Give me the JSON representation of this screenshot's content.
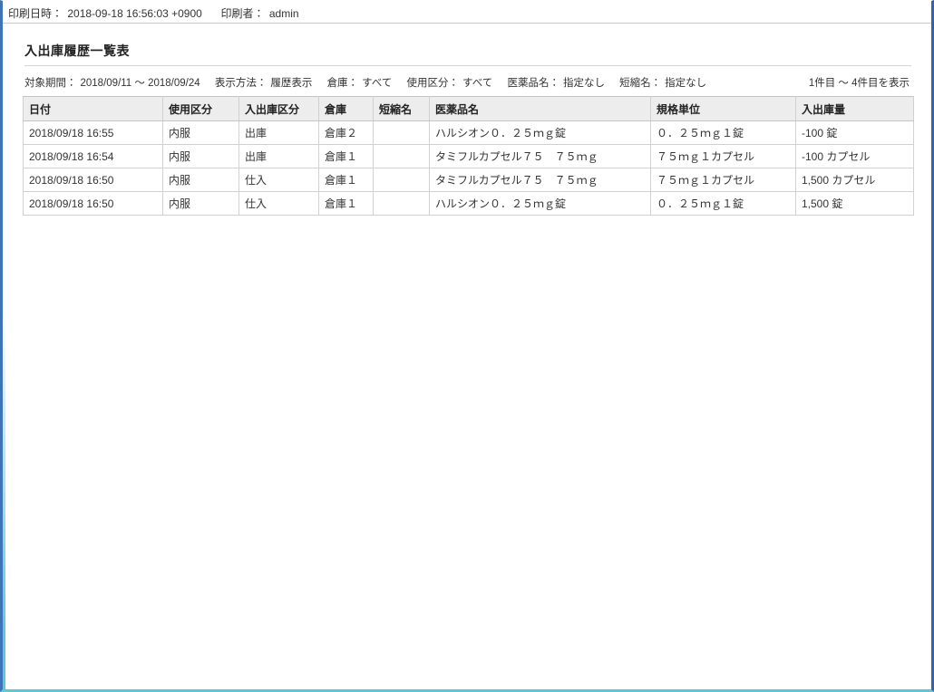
{
  "window": {
    "border_left_color": "#3f73b8",
    "border_right_color": "#2f63ad",
    "border_bottom_color": "#5ec8d8"
  },
  "print_header": {
    "datetime_label": "印刷日時：",
    "datetime_value": "2018-09-18 16:56:03 +0900",
    "user_label": "印刷者：",
    "user_value": "admin"
  },
  "page": {
    "title": "入出庫履歴一覧表"
  },
  "criteria": {
    "items": [
      {
        "key": "対象期間：",
        "value": "2018/09/11 ～ 2018/09/24"
      },
      {
        "key": "表示方法：",
        "value": "履歴表示"
      },
      {
        "key": "倉庫：",
        "value": "すべて"
      },
      {
        "key": "使用区分：",
        "value": "すべて"
      },
      {
        "key": "医薬品名：",
        "value": "指定なし"
      },
      {
        "key": "短縮名：",
        "value": "指定なし"
      }
    ],
    "record_range": "1件目 ～ 4件目を表示"
  },
  "table": {
    "headers": [
      "日付",
      "使用区分",
      "入出庫区分",
      "倉庫",
      "短縮名",
      "医薬品名",
      "規格単位",
      "入出庫量"
    ],
    "rows": [
      {
        "date": "2018/09/18 16:55",
        "usage": "内服",
        "io_type": "出庫",
        "warehouse": "倉庫２",
        "short_name": "",
        "drug_name": "ハルシオン０．２５ｍｇ錠",
        "unit": "０．２５ｍｇ１錠",
        "quantity": "-100 錠"
      },
      {
        "date": "2018/09/18 16:54",
        "usage": "内服",
        "io_type": "出庫",
        "warehouse": "倉庫１",
        "short_name": "",
        "drug_name": "タミフルカプセル７５　７５ｍｇ",
        "unit": "７５ｍｇ１カプセル",
        "quantity": "-100 カプセル"
      },
      {
        "date": "2018/09/18 16:50",
        "usage": "内服",
        "io_type": "仕入",
        "warehouse": "倉庫１",
        "short_name": "",
        "drug_name": "タミフルカプセル７５　７５ｍｇ",
        "unit": "７５ｍｇ１カプセル",
        "quantity": "1,500 カプセル"
      },
      {
        "date": "2018/09/18 16:50",
        "usage": "内服",
        "io_type": "仕入",
        "warehouse": "倉庫１",
        "short_name": "",
        "drug_name": "ハルシオン０．２５ｍｇ錠",
        "unit": "０．２５ｍｇ１錠",
        "quantity": "1,500 錠"
      }
    ]
  }
}
